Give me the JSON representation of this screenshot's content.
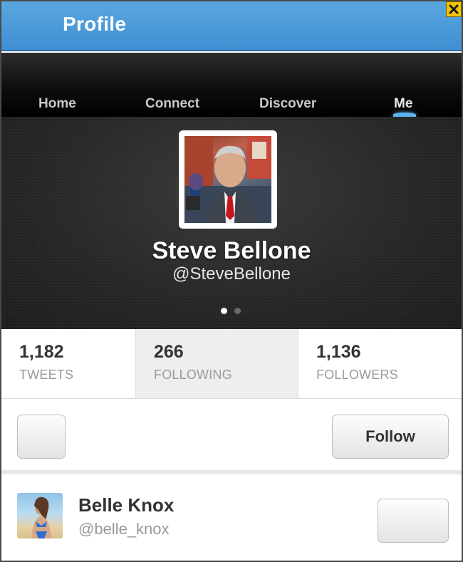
{
  "header": {
    "title": "Profile",
    "close_icon": "close-icon"
  },
  "nav": {
    "items": [
      {
        "label": "Home",
        "active": false
      },
      {
        "label": "Connect",
        "active": false
      },
      {
        "label": "Discover",
        "active": false
      },
      {
        "label": "Me",
        "active": true
      }
    ]
  },
  "profile": {
    "name": "Steve Bellone",
    "handle": "@SteveBellone",
    "page_indicator": {
      "count": 2,
      "current": 1
    }
  },
  "stats": [
    {
      "value": "1,182",
      "label": "TWEETS"
    },
    {
      "value": "266",
      "label": "FOLLOWING"
    },
    {
      "value": "1,136",
      "label": "FOLLOWERS"
    }
  ],
  "actions": {
    "follow_label": "Follow"
  },
  "suggested_user": {
    "name": "Belle Knox",
    "handle": "@belle_knox"
  },
  "colors": {
    "header_blue": "#4a9ad9",
    "accent_blue": "#5db2ee",
    "close_yellow": "#f2c400"
  }
}
